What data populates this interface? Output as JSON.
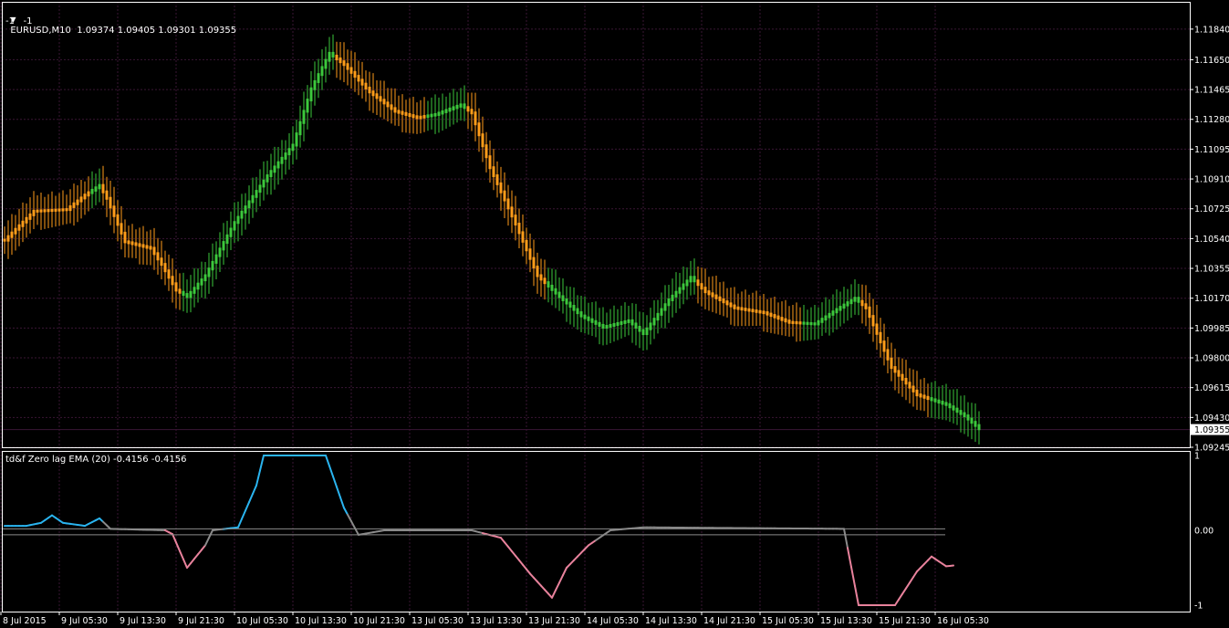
{
  "main_panel": {
    "symbol_header": "EURUSD,M10  1.09374 1.09405 1.09301 1.09355",
    "header_sub": "-1   -1",
    "current_price_label": "1.09355",
    "ylim": [
      1.09245,
      1.1193
    ]
  },
  "indicator_panel": {
    "header": "td&f Zero lag EMA (20) -0.4156 -0.4156",
    "ticks": [
      "1",
      "0.00",
      "-1"
    ],
    "ylim": [
      -1,
      1
    ]
  },
  "colors": {
    "background": "#000000",
    "grid": "#3a1634",
    "axis": "#ffffff",
    "bull": "#3cc83c",
    "bear": "#ff9d1a",
    "ind_up": "#2ab4ef",
    "ind_flat": "#8a8a8a",
    "ind_down": "#e8829c",
    "level_line": "#8a8a8a"
  },
  "chart_data": [
    {
      "type": "candlestick",
      "title": "EURUSD,M10",
      "price_ticks": [
        1.1184,
        1.1165,
        1.11465,
        1.1128,
        1.11095,
        1.1091,
        1.10725,
        1.1054,
        1.10355,
        1.1017,
        1.09985,
        1.098,
        1.09615,
        1.0943,
        1.09245
      ],
      "x_ticks": [
        "8 Jul 2015",
        "9 Jul 05:30",
        "9 Jul 13:30",
        "9 Jul 21:30",
        "10 Jul 05:30",
        "10 Jul 13:30",
        "10 Jul 21:30",
        "13 Jul 05:30",
        "13 Jul 13:30",
        "13 Jul 21:30",
        "14 Jul 05:30",
        "14 Jul 13:30",
        "14 Jul 21:30",
        "15 Jul 05:30",
        "15 Jul 13:30",
        "15 Jul 21:30",
        "16 Jul 05:30"
      ],
      "close_path": [
        {
          "i": 0,
          "v": 1.1053,
          "c": "bear"
        },
        {
          "i": 8,
          "v": 1.1071,
          "c": "bear"
        },
        {
          "i": 17,
          "v": 1.1072,
          "c": "bear"
        },
        {
          "i": 22,
          "v": 1.1081,
          "c": "bear"
        },
        {
          "i": 26,
          "v": 1.1087,
          "c": "bull"
        },
        {
          "i": 28,
          "v": 1.1079,
          "c": "bear"
        },
        {
          "i": 33,
          "v": 1.1052,
          "c": "bear"
        },
        {
          "i": 40,
          "v": 1.1048,
          "c": "bear"
        },
        {
          "i": 43,
          "v": 1.1038,
          "c": "bear"
        },
        {
          "i": 47,
          "v": 1.1022,
          "c": "bear"
        },
        {
          "i": 50,
          "v": 1.1018,
          "c": "bull"
        },
        {
          "i": 55,
          "v": 1.1031,
          "c": "bull"
        },
        {
          "i": 63,
          "v": 1.1064,
          "c": "bull"
        },
        {
          "i": 72,
          "v": 1.1093,
          "c": "bull"
        },
        {
          "i": 79,
          "v": 1.1112,
          "c": "bull"
        },
        {
          "i": 84,
          "v": 1.1147,
          "c": "bull"
        },
        {
          "i": 89,
          "v": 1.1169,
          "c": "bull"
        },
        {
          "i": 93,
          "v": 1.1162,
          "c": "bear"
        },
        {
          "i": 100,
          "v": 1.1145,
          "c": "bear"
        },
        {
          "i": 107,
          "v": 1.1133,
          "c": "bear"
        },
        {
          "i": 113,
          "v": 1.1129,
          "c": "bear"
        },
        {
          "i": 118,
          "v": 1.1131,
          "c": "bull"
        },
        {
          "i": 125,
          "v": 1.1137,
          "c": "bull"
        },
        {
          "i": 128,
          "v": 1.1132,
          "c": "bear"
        },
        {
          "i": 133,
          "v": 1.1098,
          "c": "bear"
        },
        {
          "i": 140,
          "v": 1.1063,
          "c": "bear"
        },
        {
          "i": 146,
          "v": 1.1031,
          "c": "bear"
        },
        {
          "i": 152,
          "v": 1.1018,
          "c": "bull"
        },
        {
          "i": 158,
          "v": 1.1006,
          "c": "bull"
        },
        {
          "i": 164,
          "v": 1.0999,
          "c": "bull"
        },
        {
          "i": 171,
          "v": 1.1003,
          "c": "bull"
        },
        {
          "i": 175,
          "v": 1.0995,
          "c": "bull"
        },
        {
          "i": 182,
          "v": 1.1016,
          "c": "bull"
        },
        {
          "i": 188,
          "v": 1.103,
          "c": "bull"
        },
        {
          "i": 192,
          "v": 1.1021,
          "c": "bear"
        },
        {
          "i": 200,
          "v": 1.1011,
          "c": "bear"
        },
        {
          "i": 208,
          "v": 1.1008,
          "c": "bear"
        },
        {
          "i": 215,
          "v": 1.1002,
          "c": "bear"
        },
        {
          "i": 222,
          "v": 1.1001,
          "c": "bull"
        },
        {
          "i": 228,
          "v": 1.101,
          "c": "bull"
        },
        {
          "i": 233,
          "v": 1.1017,
          "c": "bull"
        },
        {
          "i": 236,
          "v": 1.1011,
          "c": "bear"
        },
        {
          "i": 243,
          "v": 1.0974,
          "c": "bear"
        },
        {
          "i": 250,
          "v": 1.0957,
          "c": "bear"
        },
        {
          "i": 258,
          "v": 1.0951,
          "c": "bull"
        },
        {
          "i": 263,
          "v": 1.0944,
          "c": "bull"
        },
        {
          "i": 267,
          "v": 1.0936,
          "c": "bull"
        }
      ]
    },
    {
      "type": "line",
      "title": "td&f Zero lag EMA (20)",
      "ylim": [
        -1,
        1
      ],
      "levels": [
        0.02,
        -0.06
      ],
      "path": [
        {
          "i": 0,
          "v": 0.06,
          "c": "up"
        },
        {
          "i": 6,
          "v": 0.06,
          "c": "up"
        },
        {
          "i": 10,
          "v": 0.1,
          "c": "up"
        },
        {
          "i": 13,
          "v": 0.2,
          "c": "up"
        },
        {
          "i": 16,
          "v": 0.1,
          "c": "up"
        },
        {
          "i": 22,
          "v": 0.06,
          "c": "up"
        },
        {
          "i": 26,
          "v": 0.16,
          "c": "up"
        },
        {
          "i": 29,
          "v": 0.02,
          "c": "flat"
        },
        {
          "i": 44,
          "v": 0.0,
          "c": "flat"
        },
        {
          "i": 46,
          "v": -0.05,
          "c": "down"
        },
        {
          "i": 50,
          "v": -0.5,
          "c": "down"
        },
        {
          "i": 55,
          "v": -0.2,
          "c": "down"
        },
        {
          "i": 57,
          "v": 0.0,
          "c": "flat"
        },
        {
          "i": 64,
          "v": 0.04,
          "c": "up"
        },
        {
          "i": 69,
          "v": 0.6,
          "c": "up"
        },
        {
          "i": 71,
          "v": 1.0,
          "c": "up"
        },
        {
          "i": 88,
          "v": 1.0,
          "c": "up"
        },
        {
          "i": 93,
          "v": 0.3,
          "c": "up"
        },
        {
          "i": 97,
          "v": -0.06,
          "c": "flat"
        },
        {
          "i": 104,
          "v": 0.0,
          "c": "flat"
        },
        {
          "i": 128,
          "v": 0.0,
          "c": "flat"
        },
        {
          "i": 136,
          "v": -0.1,
          "c": "down"
        },
        {
          "i": 144,
          "v": -0.58,
          "c": "down"
        },
        {
          "i": 150,
          "v": -0.9,
          "c": "down"
        },
        {
          "i": 154,
          "v": -0.5,
          "c": "down"
        },
        {
          "i": 160,
          "v": -0.2,
          "c": "down"
        },
        {
          "i": 166,
          "v": 0.0,
          "c": "flat"
        },
        {
          "i": 175,
          "v": 0.04,
          "c": "flat"
        },
        {
          "i": 230,
          "v": 0.02,
          "c": "flat"
        },
        {
          "i": 234,
          "v": -1.0,
          "c": "down"
        },
        {
          "i": 244,
          "v": -1.0,
          "c": "down"
        },
        {
          "i": 250,
          "v": -0.55,
          "c": "down"
        },
        {
          "i": 254,
          "v": -0.35,
          "c": "down"
        },
        {
          "i": 258,
          "v": -0.48,
          "c": "down"
        },
        {
          "i": 260,
          "v": -0.47,
          "c": "down"
        }
      ]
    }
  ]
}
